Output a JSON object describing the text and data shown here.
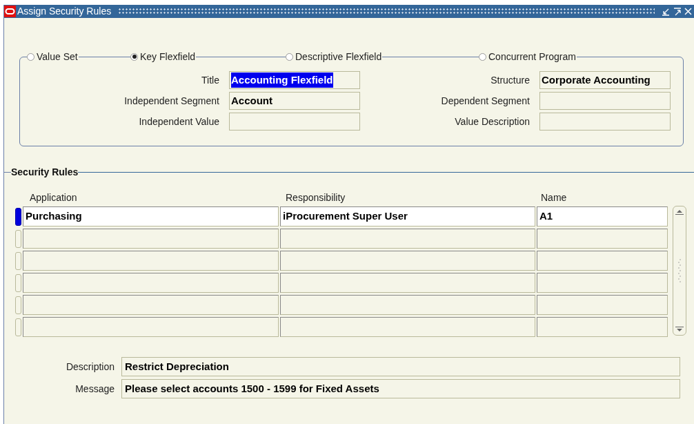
{
  "window": {
    "title": "Assign Security Rules"
  },
  "radio_options": [
    {
      "label": "Value Set",
      "selected": false
    },
    {
      "label": "Key Flexfield",
      "selected": true
    },
    {
      "label": "Descriptive Flexfield",
      "selected": false
    },
    {
      "label": "Concurrent Program",
      "selected": false
    }
  ],
  "fields_left": [
    {
      "label": "Title",
      "value": "Accounting Flexfield",
      "highlighted": true
    },
    {
      "label": "Independent Segment",
      "value": "Account",
      "highlighted": false
    },
    {
      "label": "Independent Value"
    }
  ],
  "fields_right": [
    {
      "label": "Structure",
      "value": "Corporate Accounting",
      "highlighted": false
    },
    {
      "label": "Dependent Segment"
    },
    {
      "label": "Value Description"
    }
  ],
  "security_rules": {
    "title": "Security Rules",
    "columns": [
      "Application",
      "Responsibility",
      "Name"
    ],
    "rows": [
      {
        "selected": true,
        "cells": [
          "Purchasing",
          "iProcurement Super User",
          "A1"
        ]
      },
      {
        "selected": false,
        "cells": []
      },
      {
        "selected": false,
        "cells": []
      },
      {
        "selected": false,
        "cells": []
      },
      {
        "selected": false,
        "cells": []
      },
      {
        "selected": false,
        "cells": []
      }
    ]
  },
  "details": [
    {
      "label": "Description",
      "value": "Restrict Depreciation"
    },
    {
      "label": "Message",
      "value": "Please select accounts 1500 - 1599 for Fixed Assets"
    }
  ]
}
